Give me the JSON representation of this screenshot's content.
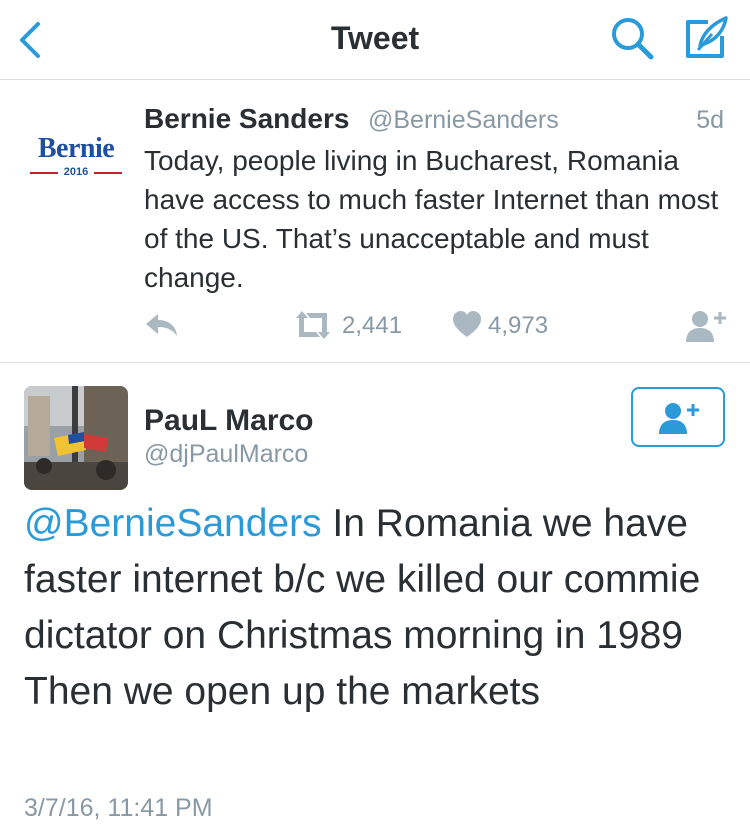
{
  "nav": {
    "title": "Tweet",
    "back_icon": "chevron-left-icon",
    "search_icon": "search-icon",
    "compose_icon": "compose-icon",
    "accent": "#2b9ad8"
  },
  "tweet1": {
    "logo_text": "Bernie",
    "logo_year": "2016",
    "name": "Bernie Sanders",
    "handle": "@BernieSanders",
    "time": "5d",
    "text": "Today, people living in Bucharest, Romania have access to much faster Internet than most of the US. That’s unacceptable and must change.",
    "retweet_count": "2,441",
    "like_count": "4,973"
  },
  "tweet2": {
    "name": "PauL Marco",
    "handle": "@djPaulMarco",
    "mention": "@BernieSanders",
    "text": " In Romania we have faster internet b/c we killed our commie dictator on Christmas morning in 1989 Then we open up the markets",
    "timestamp": "3/7/16, 11:41 PM"
  },
  "colors": {
    "text": "#292f33",
    "muted": "#8899a6",
    "link": "#2b9ad8",
    "divider": "#d8dde1"
  }
}
